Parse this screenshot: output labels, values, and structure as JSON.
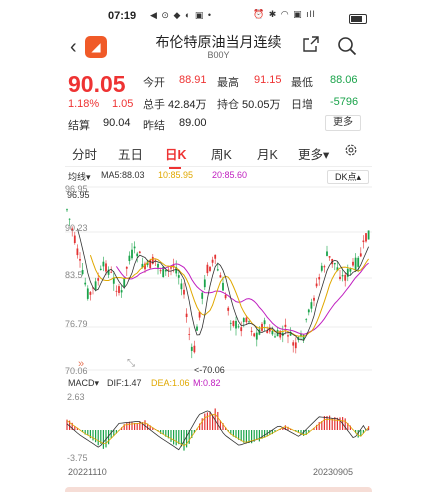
{
  "status": {
    "time": "07:19",
    "left_icons": "◀ ⊙ ◆ ◐ ▣ •",
    "right_icons": "⏰ ✱ ◠ ▣ ıll"
  },
  "header": {
    "title": "布伦特原油当月连续",
    "code": "B00Y"
  },
  "quote": {
    "price": "90.05",
    "pct": "1.18%",
    "change": "1.05",
    "open_label": "今开",
    "open": "88.91",
    "high_label": "最高",
    "high": "91.15",
    "low_label": "最低",
    "low": "88.06",
    "volume_label": "总手",
    "volume": "42.84万",
    "position_label": "持仓",
    "position": "50.05万",
    "daily_add_label": "日增",
    "daily_add": "-5796",
    "settle_label": "结算",
    "settle": "90.04",
    "prev_settle_label": "昨结",
    "prev_settle": "89.00",
    "more_label": "更多"
  },
  "tabs": [
    "分时",
    "五日",
    "日K",
    "周K",
    "月K",
    "更多▾"
  ],
  "active_tab": 2,
  "ma": {
    "type_label": "均线▾",
    "ma5": "MA5:88.03",
    "ma10": "10:85.95",
    "ma20": "20:85.60",
    "dk_label": "DK点▴"
  },
  "kline": {
    "y_labels": [
      "96.95",
      "90.23",
      "83.5",
      "76.79",
      "70.06"
    ],
    "high_marker": "96.95",
    "low_marker": "<-70.06",
    "up_color": "#e33333",
    "down_color": "#1aa34a"
  },
  "macd": {
    "label": "MACD▾",
    "dif": "DIF:1.47",
    "dea": "DEA:1.06",
    "m": "M:0.82",
    "y_top": "2.63",
    "y_bottom": "-3.75",
    "date_start": "20221110",
    "date_end": "20230905"
  },
  "colors": {
    "accent": "#e33333",
    "green": "#1aa34a",
    "ma5": "#333333",
    "ma10": "#e0a800",
    "ma20": "#c020c0"
  }
}
